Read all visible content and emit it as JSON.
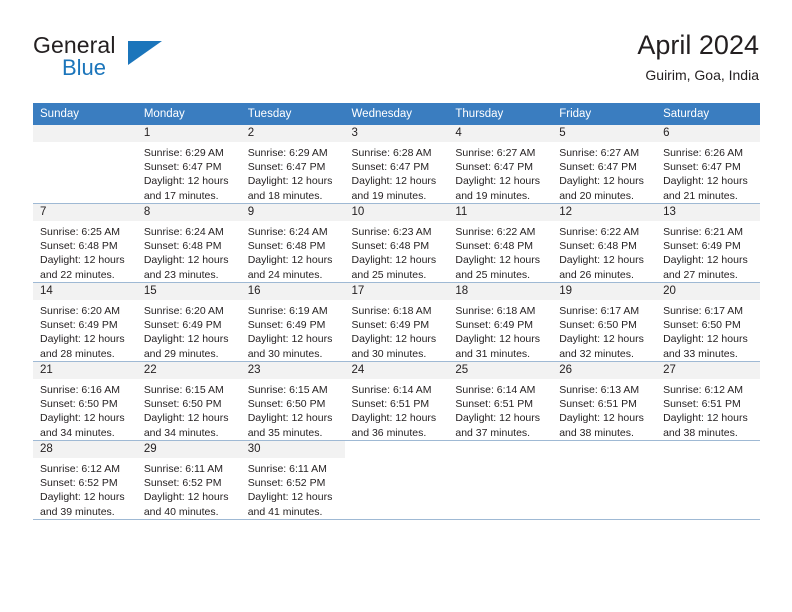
{
  "brand": {
    "name_part1": "General",
    "name_part2": "Blue",
    "flag_icon": "triangle-flag-icon",
    "accent_color": "#1b75bb"
  },
  "header": {
    "title": "April 2024",
    "subtitle": "Guirim, Goa, India"
  },
  "theme": {
    "header_row_bg": "#3a7dc0",
    "daynum_band_bg": "#f2f2f2",
    "grid_line": "#9fb9d4",
    "text": "#231f20"
  },
  "weekday_headers": [
    "Sunday",
    "Monday",
    "Tuesday",
    "Wednesday",
    "Thursday",
    "Friday",
    "Saturday"
  ],
  "weeks": [
    [
      {
        "day": "",
        "sunrise": "",
        "sunset": "",
        "daylight_line1": "",
        "daylight_line2": "",
        "empty": true
      },
      {
        "day": "1",
        "sunrise": "Sunrise: 6:29 AM",
        "sunset": "Sunset: 6:47 PM",
        "daylight_line1": "Daylight: 12 hours",
        "daylight_line2": "and 17 minutes."
      },
      {
        "day": "2",
        "sunrise": "Sunrise: 6:29 AM",
        "sunset": "Sunset: 6:47 PM",
        "daylight_line1": "Daylight: 12 hours",
        "daylight_line2": "and 18 minutes."
      },
      {
        "day": "3",
        "sunrise": "Sunrise: 6:28 AM",
        "sunset": "Sunset: 6:47 PM",
        "daylight_line1": "Daylight: 12 hours",
        "daylight_line2": "and 19 minutes."
      },
      {
        "day": "4",
        "sunrise": "Sunrise: 6:27 AM",
        "sunset": "Sunset: 6:47 PM",
        "daylight_line1": "Daylight: 12 hours",
        "daylight_line2": "and 19 minutes."
      },
      {
        "day": "5",
        "sunrise": "Sunrise: 6:27 AM",
        "sunset": "Sunset: 6:47 PM",
        "daylight_line1": "Daylight: 12 hours",
        "daylight_line2": "and 20 minutes."
      },
      {
        "day": "6",
        "sunrise": "Sunrise: 6:26 AM",
        "sunset": "Sunset: 6:47 PM",
        "daylight_line1": "Daylight: 12 hours",
        "daylight_line2": "and 21 minutes."
      }
    ],
    [
      {
        "day": "7",
        "sunrise": "Sunrise: 6:25 AM",
        "sunset": "Sunset: 6:48 PM",
        "daylight_line1": "Daylight: 12 hours",
        "daylight_line2": "and 22 minutes."
      },
      {
        "day": "8",
        "sunrise": "Sunrise: 6:24 AM",
        "sunset": "Sunset: 6:48 PM",
        "daylight_line1": "Daylight: 12 hours",
        "daylight_line2": "and 23 minutes."
      },
      {
        "day": "9",
        "sunrise": "Sunrise: 6:24 AM",
        "sunset": "Sunset: 6:48 PM",
        "daylight_line1": "Daylight: 12 hours",
        "daylight_line2": "and 24 minutes."
      },
      {
        "day": "10",
        "sunrise": "Sunrise: 6:23 AM",
        "sunset": "Sunset: 6:48 PM",
        "daylight_line1": "Daylight: 12 hours",
        "daylight_line2": "and 25 minutes."
      },
      {
        "day": "11",
        "sunrise": "Sunrise: 6:22 AM",
        "sunset": "Sunset: 6:48 PM",
        "daylight_line1": "Daylight: 12 hours",
        "daylight_line2": "and 25 minutes."
      },
      {
        "day": "12",
        "sunrise": "Sunrise: 6:22 AM",
        "sunset": "Sunset: 6:48 PM",
        "daylight_line1": "Daylight: 12 hours",
        "daylight_line2": "and 26 minutes."
      },
      {
        "day": "13",
        "sunrise": "Sunrise: 6:21 AM",
        "sunset": "Sunset: 6:49 PM",
        "daylight_line1": "Daylight: 12 hours",
        "daylight_line2": "and 27 minutes."
      }
    ],
    [
      {
        "day": "14",
        "sunrise": "Sunrise: 6:20 AM",
        "sunset": "Sunset: 6:49 PM",
        "daylight_line1": "Daylight: 12 hours",
        "daylight_line2": "and 28 minutes."
      },
      {
        "day": "15",
        "sunrise": "Sunrise: 6:20 AM",
        "sunset": "Sunset: 6:49 PM",
        "daylight_line1": "Daylight: 12 hours",
        "daylight_line2": "and 29 minutes."
      },
      {
        "day": "16",
        "sunrise": "Sunrise: 6:19 AM",
        "sunset": "Sunset: 6:49 PM",
        "daylight_line1": "Daylight: 12 hours",
        "daylight_line2": "and 30 minutes."
      },
      {
        "day": "17",
        "sunrise": "Sunrise: 6:18 AM",
        "sunset": "Sunset: 6:49 PM",
        "daylight_line1": "Daylight: 12 hours",
        "daylight_line2": "and 30 minutes."
      },
      {
        "day": "18",
        "sunrise": "Sunrise: 6:18 AM",
        "sunset": "Sunset: 6:49 PM",
        "daylight_line1": "Daylight: 12 hours",
        "daylight_line2": "and 31 minutes."
      },
      {
        "day": "19",
        "sunrise": "Sunrise: 6:17 AM",
        "sunset": "Sunset: 6:50 PM",
        "daylight_line1": "Daylight: 12 hours",
        "daylight_line2": "and 32 minutes."
      },
      {
        "day": "20",
        "sunrise": "Sunrise: 6:17 AM",
        "sunset": "Sunset: 6:50 PM",
        "daylight_line1": "Daylight: 12 hours",
        "daylight_line2": "and 33 minutes."
      }
    ],
    [
      {
        "day": "21",
        "sunrise": "Sunrise: 6:16 AM",
        "sunset": "Sunset: 6:50 PM",
        "daylight_line1": "Daylight: 12 hours",
        "daylight_line2": "and 34 minutes."
      },
      {
        "day": "22",
        "sunrise": "Sunrise: 6:15 AM",
        "sunset": "Sunset: 6:50 PM",
        "daylight_line1": "Daylight: 12 hours",
        "daylight_line2": "and 34 minutes."
      },
      {
        "day": "23",
        "sunrise": "Sunrise: 6:15 AM",
        "sunset": "Sunset: 6:50 PM",
        "daylight_line1": "Daylight: 12 hours",
        "daylight_line2": "and 35 minutes."
      },
      {
        "day": "24",
        "sunrise": "Sunrise: 6:14 AM",
        "sunset": "Sunset: 6:51 PM",
        "daylight_line1": "Daylight: 12 hours",
        "daylight_line2": "and 36 minutes."
      },
      {
        "day": "25",
        "sunrise": "Sunrise: 6:14 AM",
        "sunset": "Sunset: 6:51 PM",
        "daylight_line1": "Daylight: 12 hours",
        "daylight_line2": "and 37 minutes."
      },
      {
        "day": "26",
        "sunrise": "Sunrise: 6:13 AM",
        "sunset": "Sunset: 6:51 PM",
        "daylight_line1": "Daylight: 12 hours",
        "daylight_line2": "and 38 minutes."
      },
      {
        "day": "27",
        "sunrise": "Sunrise: 6:12 AM",
        "sunset": "Sunset: 6:51 PM",
        "daylight_line1": "Daylight: 12 hours",
        "daylight_line2": "and 38 minutes."
      }
    ],
    [
      {
        "day": "28",
        "sunrise": "Sunrise: 6:12 AM",
        "sunset": "Sunset: 6:52 PM",
        "daylight_line1": "Daylight: 12 hours",
        "daylight_line2": "and 39 minutes."
      },
      {
        "day": "29",
        "sunrise": "Sunrise: 6:11 AM",
        "sunset": "Sunset: 6:52 PM",
        "daylight_line1": "Daylight: 12 hours",
        "daylight_line2": "and 40 minutes."
      },
      {
        "day": "30",
        "sunrise": "Sunrise: 6:11 AM",
        "sunset": "Sunset: 6:52 PM",
        "daylight_line1": "Daylight: 12 hours",
        "daylight_line2": "and 41 minutes."
      },
      {
        "day": "",
        "sunrise": "",
        "sunset": "",
        "daylight_line1": "",
        "daylight_line2": "",
        "blank": true
      },
      {
        "day": "",
        "sunrise": "",
        "sunset": "",
        "daylight_line1": "",
        "daylight_line2": "",
        "blank": true
      },
      {
        "day": "",
        "sunrise": "",
        "sunset": "",
        "daylight_line1": "",
        "daylight_line2": "",
        "blank": true
      },
      {
        "day": "",
        "sunrise": "",
        "sunset": "",
        "daylight_line1": "",
        "daylight_line2": "",
        "blank": true
      }
    ]
  ]
}
